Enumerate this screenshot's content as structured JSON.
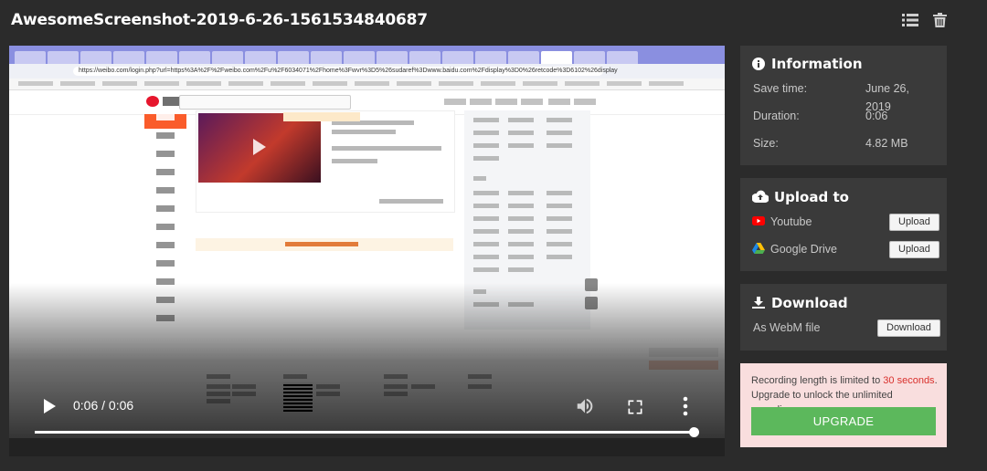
{
  "header": {
    "title": "AwesomeScreenshot-2019-6-26-1561534840687",
    "list_icon": "list-icon",
    "trash_icon": "trash-icon"
  },
  "video": {
    "browser_url": "https://weibo.com/login.php?url=https%3A%2F%2Fweibo.com%2Fu%2F6034071%2Fhome%3Fwvr%3D5%26sudaref%3Dwww.baidu.com%2Fdisplay%3D0%26retcode%3D6102%26display",
    "time_display": "0:06 / 0:06",
    "progress_fraction": 1.0,
    "play_icon": "play-icon",
    "volume_icon": "volume-icon",
    "fullscreen_icon": "fullscreen-icon",
    "more_icon": "more-vertical-icon"
  },
  "information": {
    "heading": "Information",
    "rows": [
      {
        "label": "Save time:",
        "value": "June 26, 2019"
      },
      {
        "label": "Duration:",
        "value": "0:06"
      },
      {
        "label": "Size:",
        "value": "4.82 MB"
      }
    ]
  },
  "upload": {
    "heading": "Upload to",
    "items": [
      {
        "name": "Youtube",
        "button": "Upload"
      },
      {
        "name": "Google Drive",
        "button": "Upload"
      }
    ]
  },
  "download": {
    "heading": "Download",
    "item": "As WebM file",
    "button": "Download"
  },
  "promo": {
    "text_before": "Recording length is limited to ",
    "highlight": "30 seconds",
    "text_after": ". Upgrade to unlock the unlimited recordings.",
    "button": "UPGRADE"
  },
  "colors": {
    "background": "#2b2b2b",
    "card": "#3a3a3a",
    "upgrade_green": "#5cb85c",
    "promo_bg": "#f9dede",
    "highlight_red": "#d9302c",
    "youtube_red": "#ff0000"
  }
}
